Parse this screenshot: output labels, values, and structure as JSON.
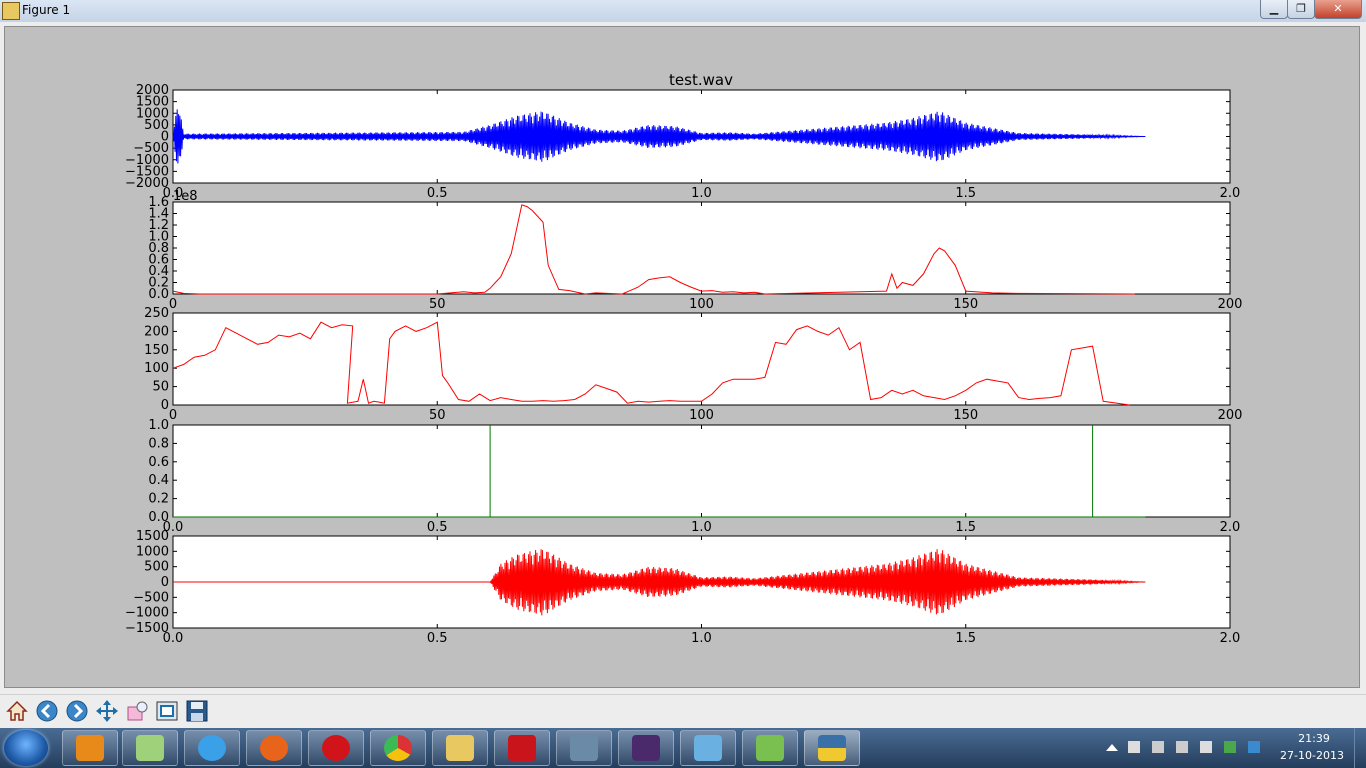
{
  "window": {
    "title": "Figure 1",
    "minimize_glyph": "▁",
    "maximize_glyph": "❐",
    "close_glyph": "✕"
  },
  "figure": {
    "title": "test.wav"
  },
  "axes": [
    {
      "id": "ax1",
      "yticks": [
        "2000",
        "1500",
        "1000",
        "500",
        "0",
        "−500",
        "−1000",
        "−1500",
        "−2000"
      ],
      "xticks": [
        "0.0",
        "0.5",
        "1.0",
        "1.5",
        "2.0"
      ],
      "offset_text": ""
    },
    {
      "id": "ax2",
      "yticks": [
        "1.6",
        "1.4",
        "1.2",
        "1.0",
        "0.8",
        "0.6",
        "0.4",
        "0.2",
        "0.0"
      ],
      "xticks": [
        "0",
        "50",
        "100",
        "150",
        "200"
      ],
      "offset_text": "1e8"
    },
    {
      "id": "ax3",
      "yticks": [
        "250",
        "200",
        "150",
        "100",
        "50",
        "0"
      ],
      "xticks": [
        "0",
        "50",
        "100",
        "150",
        "200"
      ],
      "offset_text": ""
    },
    {
      "id": "ax4",
      "yticks": [
        "1.0",
        "0.8",
        "0.6",
        "0.4",
        "0.2",
        "0.0"
      ],
      "xticks": [
        "0.0",
        "0.5",
        "1.0",
        "1.5",
        "2.0"
      ],
      "offset_text": ""
    },
    {
      "id": "ax5",
      "yticks": [
        "1500",
        "1000",
        "500",
        "0",
        "−500",
        "−1000",
        "−1500"
      ],
      "xticks": [
        "0.0",
        "0.5",
        "1.0",
        "1.5",
        "2.0"
      ],
      "offset_text": ""
    }
  ],
  "chart_data": [
    {
      "type": "line",
      "title": "test.wav",
      "color": "#0000ff",
      "xlim": [
        0,
        2.0
      ],
      "ylim": [
        -2000,
        2000
      ],
      "series": [
        {
          "values_description_free": true,
          "x": [
            0.0,
            0.01,
            0.02,
            0.55,
            0.6,
            0.65,
            0.7,
            0.75,
            0.8,
            0.85,
            0.9,
            0.95,
            1.0,
            1.05,
            1.1,
            1.35,
            1.4,
            1.45,
            1.5,
            1.6,
            1.74,
            1.84
          ],
          "y_amplitude": [
            100,
            1600,
            120,
            200,
            500,
            900,
            1100,
            600,
            300,
            250,
            500,
            450,
            150,
            180,
            120,
            600,
            800,
            1100,
            600,
            150,
            80,
            0
          ]
        }
      ]
    },
    {
      "type": "line",
      "color": "#ff0000",
      "xlim": [
        0,
        200
      ],
      "ylim": [
        0,
        1.6
      ],
      "y_multiplier": "1e8",
      "series": [
        {
          "x": [
            0,
            2,
            5,
            20,
            50,
            55,
            57,
            59,
            60,
            61,
            62,
            64,
            66,
            67,
            68,
            70,
            71,
            73,
            75,
            78,
            80,
            85,
            88,
            90,
            92,
            94,
            96,
            98,
            100,
            102,
            104,
            106,
            108,
            110,
            112,
            135,
            136,
            137,
            138,
            140,
            142,
            144,
            145,
            146,
            148,
            150,
            155,
            160,
            182
          ],
          "y": [
            0.05,
            0.01,
            0.0,
            0.0,
            0.0,
            0.04,
            0.02,
            0.03,
            0.1,
            0.2,
            0.3,
            0.7,
            1.55,
            1.52,
            1.45,
            1.25,
            0.5,
            0.08,
            0.06,
            0.0,
            0.02,
            0.0,
            0.12,
            0.25,
            0.28,
            0.3,
            0.2,
            0.12,
            0.05,
            0.06,
            0.03,
            0.04,
            0.02,
            0.03,
            0.0,
            0.05,
            0.35,
            0.1,
            0.2,
            0.15,
            0.35,
            0.7,
            0.8,
            0.75,
            0.5,
            0.05,
            0.02,
            0.01,
            0.0
          ]
        }
      ]
    },
    {
      "type": "line",
      "color": "#ff0000",
      "xlim": [
        0,
        200
      ],
      "ylim": [
        0,
        250
      ],
      "series": [
        {
          "x": [
            0,
            2,
            4,
            6,
            8,
            10,
            12,
            14,
            16,
            18,
            20,
            22,
            24,
            26,
            28,
            30,
            32,
            34,
            33,
            35,
            36,
            37,
            38,
            39,
            40,
            41,
            42,
            44,
            46,
            48,
            50,
            51,
            52,
            54,
            56,
            58,
            60,
            62,
            64,
            66,
            68,
            70,
            72,
            74,
            76,
            78,
            80,
            82,
            84,
            86,
            88,
            90,
            92,
            94,
            96,
            98,
            100,
            102,
            104,
            106,
            108,
            110,
            112,
            114,
            116,
            118,
            120,
            122,
            124,
            126,
            128,
            130,
            132,
            134,
            136,
            138,
            140,
            142,
            144,
            146,
            148,
            150,
            152,
            154,
            156,
            158,
            160,
            162,
            164,
            166,
            168,
            170,
            172,
            174,
            176,
            181
          ],
          "y": [
            100,
            110,
            130,
            135,
            150,
            210,
            195,
            180,
            165,
            170,
            190,
            185,
            195,
            180,
            225,
            210,
            218,
            215,
            5,
            10,
            70,
            5,
            10,
            8,
            5,
            180,
            200,
            215,
            200,
            210,
            225,
            80,
            60,
            15,
            10,
            30,
            12,
            20,
            15,
            10,
            10,
            12,
            10,
            12,
            15,
            30,
            55,
            45,
            35,
            5,
            10,
            8,
            10,
            12,
            10,
            10,
            10,
            30,
            60,
            70,
            70,
            70,
            75,
            170,
            165,
            205,
            215,
            200,
            190,
            210,
            150,
            170,
            15,
            20,
            40,
            30,
            40,
            25,
            20,
            15,
            25,
            40,
            60,
            70,
            65,
            60,
            20,
            15,
            18,
            20,
            25,
            150,
            155,
            160,
            10,
            0
          ]
        }
      ]
    },
    {
      "type": "line",
      "color": "#007700",
      "xlim": [
        0,
        2.0
      ],
      "ylim": [
        0,
        1.0
      ],
      "series": [
        {
          "x": [
            0.0,
            0.6,
            0.6,
            0.6,
            1.74,
            1.74,
            1.74,
            1.84
          ],
          "y": [
            0,
            0,
            1,
            0,
            0,
            1,
            0,
            0
          ]
        }
      ]
    },
    {
      "type": "line",
      "color": "#ff0000",
      "xlim": [
        0,
        2.0
      ],
      "ylim": [
        -1500,
        1500
      ],
      "series": [
        {
          "x": [
            0.0,
            0.6,
            0.62,
            0.65,
            0.7,
            0.75,
            0.8,
            0.85,
            0.9,
            0.95,
            1.0,
            1.05,
            1.1,
            1.35,
            1.4,
            1.45,
            1.5,
            1.6,
            1.74,
            1.84
          ],
          "y_amplitude": [
            0,
            0,
            600,
            900,
            1100,
            600,
            300,
            250,
            500,
            450,
            150,
            180,
            120,
            600,
            800,
            1100,
            600,
            150,
            80,
            0
          ]
        }
      ]
    }
  ],
  "toolbar": {
    "icons": [
      "home-icon",
      "back-icon",
      "forward-icon",
      "pan-icon",
      "zoom-icon",
      "subplots-icon",
      "save-icon"
    ]
  },
  "taskbar": {
    "apps": [
      "media-player",
      "file-manager",
      "internet-explorer",
      "firefox",
      "opera",
      "chrome",
      "explorer-folder",
      "acrobat",
      "lync",
      "java-ee-ide",
      "control-panel",
      "notepad-plus-plus",
      "python"
    ],
    "clock_time": "21:39",
    "clock_date": "27-10-2013"
  }
}
